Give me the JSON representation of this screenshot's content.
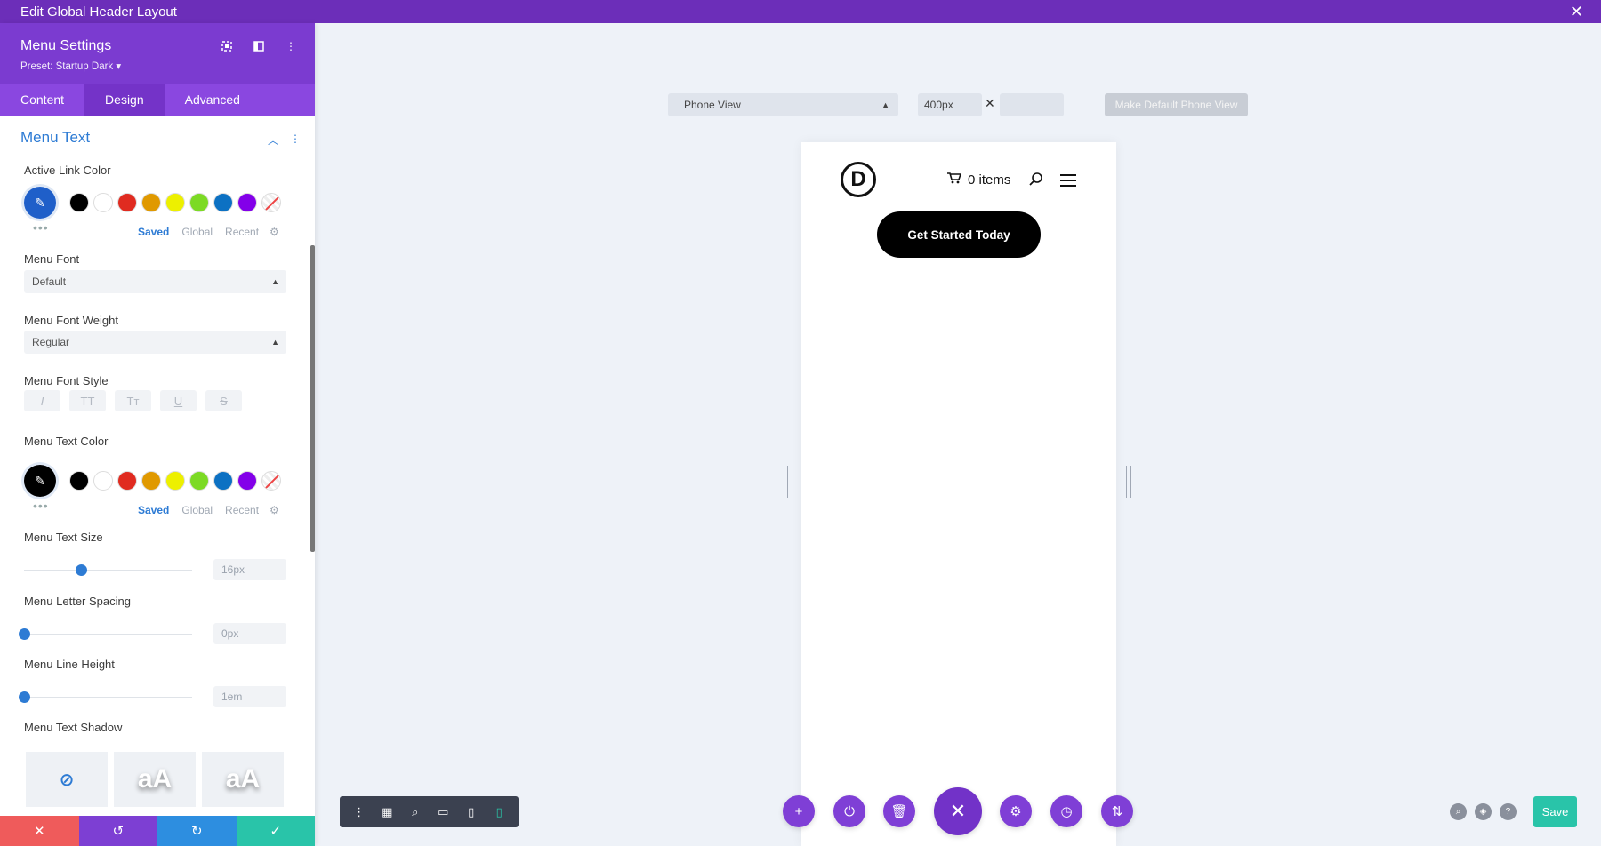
{
  "window": {
    "title": "Edit Global Header Layout"
  },
  "sidebar": {
    "title": "Menu Settings",
    "preset": "Preset: Startup Dark ▾",
    "tabs": [
      "Content",
      "Design",
      "Advanced"
    ],
    "section_title": "Menu Text",
    "active_link_color": {
      "label": "Active Link Color",
      "current": "#1f5fc9",
      "swatches": [
        "#000000",
        "#ffffff",
        "#e02b20",
        "#e09900",
        "#edf000",
        "#7cda24",
        "#0c71c3",
        "#8300e9"
      ]
    },
    "palette_tabs": [
      "Saved",
      "Global",
      "Recent"
    ],
    "dots": "•••",
    "menu_font": {
      "label": "Menu Font",
      "value": "Default"
    },
    "menu_font_weight": {
      "label": "Menu Font Weight",
      "value": "Regular"
    },
    "menu_font_style": {
      "label": "Menu Font Style",
      "buttons": [
        "I",
        "TT",
        "Tт",
        "U",
        "S"
      ]
    },
    "menu_text_color": {
      "label": "Menu Text Color",
      "current": "#000000"
    },
    "menu_text_size": {
      "label": "Menu Text Size",
      "value": "16px",
      "level": 0.34
    },
    "menu_letter_spacing": {
      "label": "Menu Letter Spacing",
      "value": "0px",
      "level": 0.0
    },
    "menu_line_height": {
      "label": "Menu Line Height",
      "value": "1em",
      "level": 0.0
    },
    "menu_text_shadow": {
      "label": "Menu Text Shadow",
      "preview_text": "aA"
    },
    "footer_colors": [
      "#ef5b5b",
      "#7d3fd3",
      "#2d8ee0",
      "#29c4a9"
    ]
  },
  "canvas": {
    "view_select": "Phone View",
    "width_value": "400px",
    "times": "✕",
    "make_default": "Make Default Phone View",
    "cart_text": "0 items",
    "logo_letter": "D",
    "cta_label": "Get Started Today"
  },
  "save_label": "Save"
}
